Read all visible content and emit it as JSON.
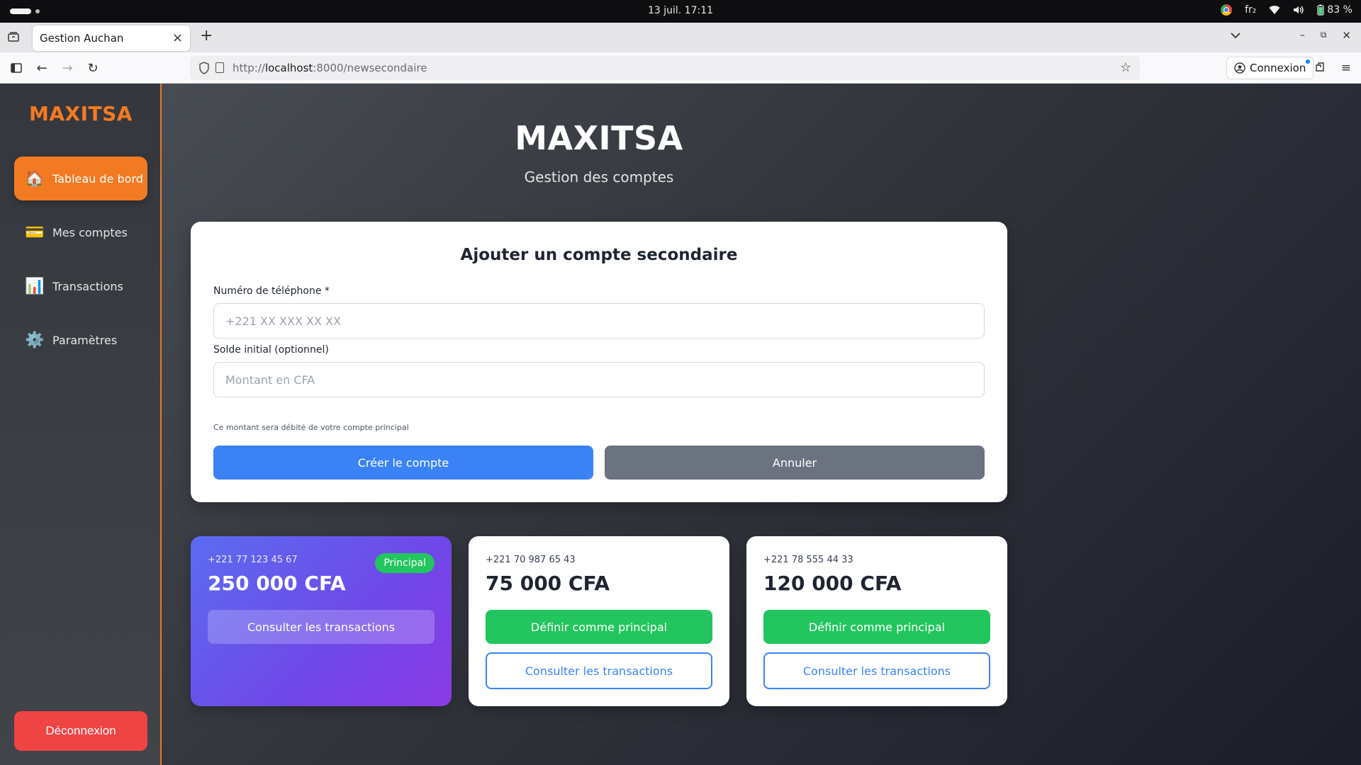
{
  "os": {
    "clock": "13 juil.  17:11",
    "keyboard": "fr₂",
    "battery": "83 %"
  },
  "browser": {
    "tab_title": "Gestion Auchan",
    "url_prefix": "http://",
    "url_host": "localhost",
    "url_path": ":8000/newsecondaire",
    "signin_label": "Connexion"
  },
  "sidebar": {
    "brand": "MAXITSA",
    "items": [
      {
        "label": "Tableau de bord",
        "icon": "🏠"
      },
      {
        "label": "Mes comptes",
        "icon": "💳"
      },
      {
        "label": "Transactions",
        "icon": "📊"
      },
      {
        "label": "Paramètres",
        "icon": "⚙️"
      }
    ],
    "logout_label": "Déconnexion"
  },
  "main": {
    "title": "MAXITSA",
    "subtitle": "Gestion des comptes"
  },
  "form": {
    "title": "Ajouter un compte secondaire",
    "phone_label": "Numéro de téléphone *",
    "phone_placeholder": "+221 XX XXX XX XX",
    "balance_label": "Solde initial (optionnel)",
    "balance_placeholder": "Montant en CFA",
    "hint": "Ce montant sera débité de votre compte principal",
    "create_label": "Créer le compte",
    "cancel_label": "Annuler"
  },
  "accounts": [
    {
      "phone": "+221 77 123 45 67",
      "amount": "250 000 CFA",
      "badge": "Principal",
      "consult_label": "Consulter les transactions"
    },
    {
      "phone": "+221 70 987 65 43",
      "amount": "75 000 CFA",
      "set_primary_label": "Définir comme principal",
      "consult_label": "Consulter les transactions"
    },
    {
      "phone": "+221 78 555 44 33",
      "amount": "120 000 CFA",
      "set_primary_label": "Définir comme principal",
      "consult_label": "Consulter les transactions"
    }
  ]
}
